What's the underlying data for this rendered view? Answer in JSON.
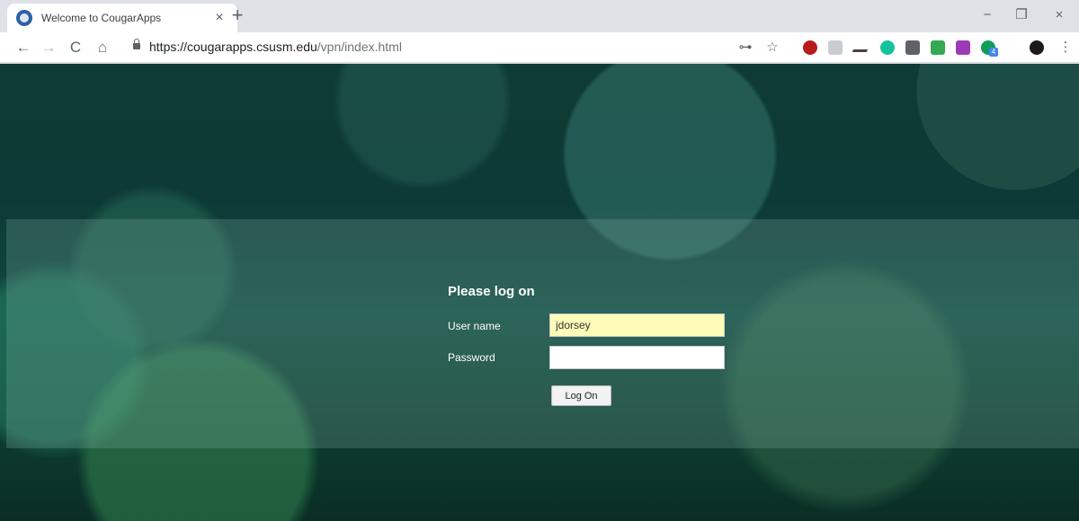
{
  "browser": {
    "tab": {
      "title": "Welcome to CougarApps",
      "close_glyph": "×"
    },
    "new_tab_glyph": "+",
    "window_controls": {
      "minimize": "−",
      "restore": "❐",
      "close": "×"
    },
    "nav": {
      "back": "←",
      "forward": "→",
      "reload": "C",
      "home": "⌂"
    },
    "address": {
      "host": "https://cougarapps.csusm.edu",
      "path": "/vpn/index.html"
    },
    "toolbar_icons": {
      "key": "key-icon",
      "star": "star-icon",
      "ublock": "ublock-origin-extension-icon",
      "chat": "chat-extension-icon",
      "pen": "pen-extension-icon",
      "grammarly": "grammarly-extension-icon",
      "sqr": "s-extension-icon",
      "sheets": "sheets-extension-icon",
      "onenote": "onenote-extension-icon",
      "hangouts": "hangouts-extension-icon",
      "profile": "profile-avatar-icon",
      "menu": "menu-icon"
    },
    "hangouts_badge": "4",
    "menu_glyph": "⋮",
    "key_glyph": "⊶",
    "star_glyph": "☆"
  },
  "login": {
    "title": "Please log on",
    "username_label": "User name",
    "username_value": "jdorsey",
    "password_label": "Password",
    "password_value": "",
    "submit_label": "Log On"
  },
  "colors": {
    "username_autofill": "#fffbb8",
    "page_background": "#0e3b33"
  }
}
